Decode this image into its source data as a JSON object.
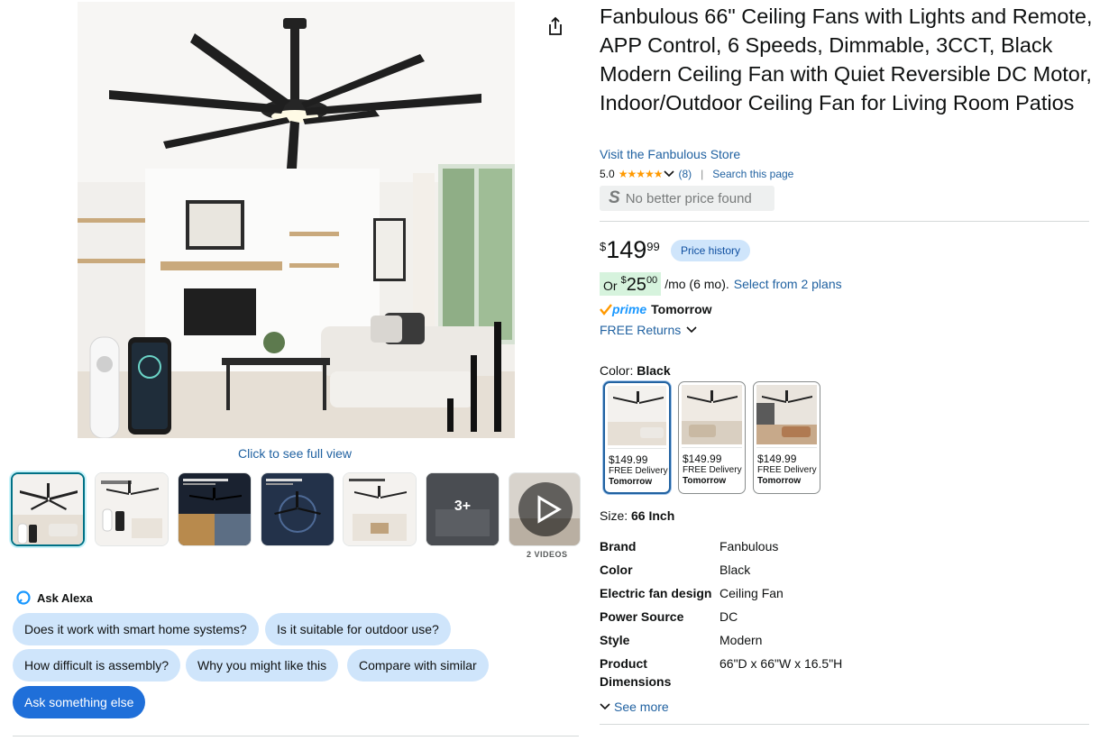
{
  "gallery": {
    "full_view_label": "Click to see full view",
    "thumbnails": [
      {
        "name": "thumb-main-living-room",
        "selected": true
      },
      {
        "name": "thumb-app-remote-control"
      },
      {
        "name": "thumb-dimmable-light"
      },
      {
        "name": "thumb-quiet-motor"
      },
      {
        "name": "thumb-ceiling-fan-set"
      },
      {
        "name": "thumb-more-images",
        "overlay": "3+"
      },
      {
        "name": "thumb-videos"
      }
    ],
    "videos_label": "2 VIDEOS",
    "thumb_top_texts": [
      "Dimmable Light",
      "Quiet Movement for Quality Sleep",
      "66 Inch Ceiling Fan"
    ]
  },
  "alexa": {
    "title": "Ask Alexa",
    "chips": [
      "Does it work with smart home systems?",
      "Is it suitable for outdoor use?",
      "How difficult is assembly?",
      "Why you might like this",
      "Compare with similar"
    ],
    "primary_chip": "Ask something else"
  },
  "product": {
    "title": "Fanbulous 66\" Ceiling Fans with Lights and Remote, APP Control, 6 Speeds, Dimmable, 3CCT, Black Modern Ceiling Fan with Quiet Reversible DC Motor, Indoor/Outdoor Ceiling Fan for Living Room Patios",
    "store_link": "Visit the Fanbulous Store",
    "rating": "5.0",
    "rating_count": "(8)",
    "search_page": "Search this page",
    "price_badge": "No better price found",
    "price_badge_logo": "S",
    "price_symbol": "$",
    "price_whole": "149",
    "price_fraction": "99",
    "price_history_label": "Price history",
    "installment": {
      "or": "Or",
      "symbol": "$",
      "amount": "25",
      "fraction": "00",
      "term": "/mo (6 mo).",
      "plans_link": "Select from 2 plans"
    },
    "prime_label": "prime",
    "delivery": "Tomorrow",
    "free_returns": "FREE Returns",
    "color_label": "Color:",
    "color_value": "Black",
    "swatches": [
      {
        "price": "$149.99",
        "delivery": "FREE Delivery",
        "when": "Tomorrow"
      },
      {
        "price": "$149.99",
        "delivery": "FREE Delivery",
        "when": "Tomorrow"
      },
      {
        "price": "$149.99",
        "delivery": "FREE Delivery",
        "when": "Tomorrow"
      }
    ],
    "size_label": "Size:",
    "size_value": "66 Inch",
    "specs": [
      {
        "key": "Brand",
        "value": "Fanbulous"
      },
      {
        "key": "Color",
        "value": "Black"
      },
      {
        "key": "Electric fan design",
        "value": "Ceiling Fan"
      },
      {
        "key": "Power Source",
        "value": "DC"
      },
      {
        "key": "Style",
        "value": "Modern"
      },
      {
        "key": "Product Dimensions",
        "value": "66\"D x 66\"W x 16.5\"H"
      }
    ],
    "see_more": "See more"
  },
  "colors": {
    "link": "#2162a1",
    "star": "#ff9900",
    "chip_bg": "#cfe5fb",
    "chip_primary": "#1f6fd9",
    "prime": "#1a98ff",
    "selected_border": "#007185"
  },
  "icons": {
    "share": "share-icon",
    "star": "star-icon",
    "chevron": "chevron-down-icon",
    "alexa": "alexa-icon",
    "play": "play-icon",
    "prime_check": "prime-check-icon"
  }
}
